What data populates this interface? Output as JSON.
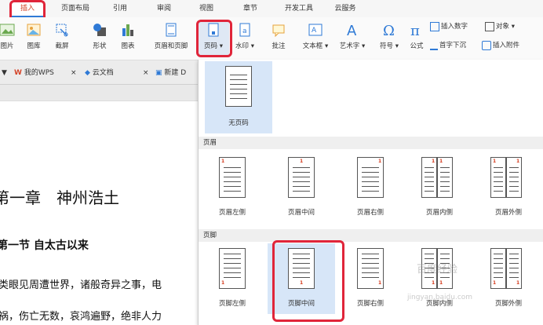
{
  "ribbon_tabs": [
    "插入",
    "页面布局",
    "引用",
    "审阅",
    "视图",
    "章节",
    "开发工具",
    "云服务"
  ],
  "ribbon_buttons": {
    "picture": "图片",
    "gallery": "图库",
    "screenshot": "截屏",
    "shapes": "形状",
    "chart": "图表",
    "header_footer": "页眉和页脚",
    "page_number": "页码",
    "watermark": "水印",
    "comment": "批注",
    "textbox": "文本框",
    "wordart": "艺术字",
    "symbol": "符号",
    "formula": "公式",
    "insert_number": "插入数字",
    "object": "对象",
    "drop_cap": "首字下沉",
    "insert_attachment": "插入附件"
  },
  "doc_tabs": {
    "mywps": "我的WPS",
    "cloud_docs": "云文档",
    "new_doc": "新建 D"
  },
  "document": {
    "chapter_title": "第一章　神州浩土",
    "section_title": "第一节 自太古以来",
    "line1": "类眼见周遭世界，诸般奇异之事，电",
    "line2": "祸，伤亡无数，哀鸿遍野，绝非人力"
  },
  "page_number_menu": {
    "no_page_number": "无页码",
    "header_section": "页眉",
    "footer_section": "页脚",
    "header_options": [
      "页眉左侧",
      "页眉中间",
      "页眉右侧",
      "页眉内侧",
      "页眉外侧"
    ],
    "footer_options": [
      "页脚左侧",
      "页脚中间",
      "页脚右侧",
      "页脚内侧",
      "页脚外侧"
    ],
    "page_digit": "1"
  },
  "watermark": {
    "text": "百度经验",
    "url": "jingyan.baidu.com"
  },
  "colors": {
    "highlight_box": "#e0253a",
    "selected_bg": "#d7e6f8",
    "active_tab": "#d4452a"
  }
}
